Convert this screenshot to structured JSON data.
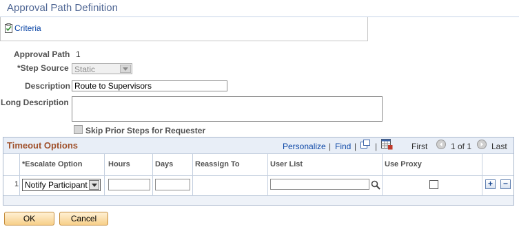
{
  "page": {
    "title": "Approval Path Definition"
  },
  "criteria": {
    "link_label": "Criteria"
  },
  "form": {
    "approval_path_label": "Approval Path",
    "approval_path_value": "1",
    "step_source_label": "*Step Source",
    "step_source_value": "Static",
    "description_label": "Description",
    "description_value": "Route to Supervisors",
    "long_description_label": "Long Description",
    "long_description_value": "",
    "skip_prior_label": "Skip Prior Steps for Requester",
    "skip_prior_checked": false
  },
  "grid": {
    "title": "Timeout Options",
    "personalize": "Personalize",
    "find": "Find",
    "separator": "|",
    "first": "First",
    "range": "1 of 1",
    "last": "Last",
    "columns": [
      "*Escalate Option",
      "Hours",
      "Days",
      "Reassign To",
      "User List",
      "Use Proxy"
    ],
    "rows": [
      {
        "num": "1",
        "escalate_option": "Notify Participant",
        "hours": "",
        "days": "",
        "reassign_to": "",
        "user_list": "",
        "use_proxy": false,
        "add_label": "+",
        "remove_label": "−"
      }
    ]
  },
  "buttons": {
    "ok": "OK",
    "cancel": "Cancel"
  },
  "colors": {
    "title": "#4f6694",
    "grid_title": "#a0522d",
    "link": "#0a45a5",
    "button": "#f7cf8a"
  }
}
